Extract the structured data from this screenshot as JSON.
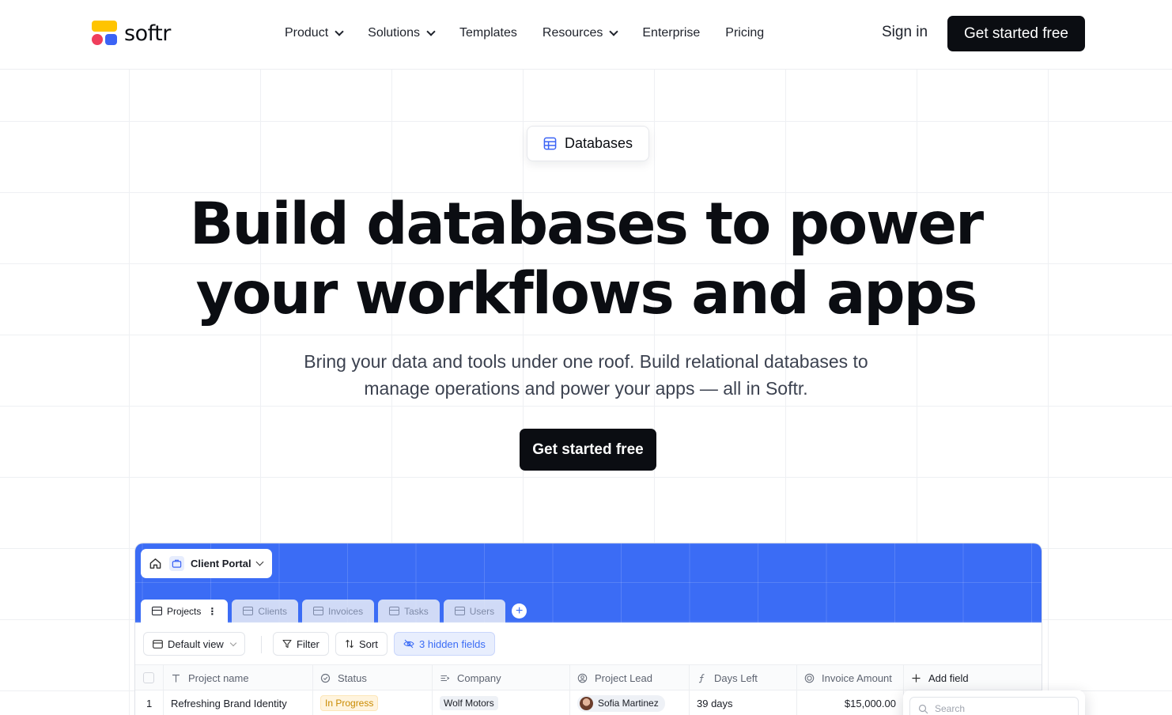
{
  "brand": {
    "name": "softr"
  },
  "nav": {
    "items": [
      {
        "label": "Product",
        "dropdown": true
      },
      {
        "label": "Solutions",
        "dropdown": true
      },
      {
        "label": "Templates",
        "dropdown": false
      },
      {
        "label": "Resources",
        "dropdown": true
      },
      {
        "label": "Enterprise",
        "dropdown": false
      },
      {
        "label": "Pricing",
        "dropdown": false
      }
    ],
    "signin_label": "Sign in",
    "cta_label": "Get started free"
  },
  "hero": {
    "badge": "Databases",
    "title_line1": "Build databases to power",
    "title_line2": "your workflows and apps",
    "subtitle_line1": "Bring your data and tools under one roof. Build relational databases to",
    "subtitle_line2": "manage operations and power your apps — all in Softr.",
    "cta_label": "Get started free"
  },
  "app": {
    "workspace": "Client Portal",
    "tabs": [
      {
        "label": "Projects",
        "active": true
      },
      {
        "label": "Clients",
        "active": false
      },
      {
        "label": "Invoices",
        "active": false
      },
      {
        "label": "Tasks",
        "active": false
      },
      {
        "label": "Users",
        "active": false
      }
    ],
    "toolbar": {
      "view_label": "Default view",
      "filter_label": "Filter",
      "sort_label": "Sort",
      "hidden_fields_label": "3 hidden fields"
    },
    "columns": [
      {
        "label": "Project name",
        "icon": "text-type-icon"
      },
      {
        "label": "Status",
        "icon": "status-circle-icon"
      },
      {
        "label": "Company",
        "icon": "link-record-icon"
      },
      {
        "label": "Project Lead",
        "icon": "user-circle-icon"
      },
      {
        "label": "Days Left",
        "icon": "formula-icon"
      },
      {
        "label": "Invoice Amount",
        "icon": "currency-icon"
      }
    ],
    "add_field_label": "Add field",
    "rows": [
      {
        "index": "1",
        "project_name": "Refreshing Brand Identity",
        "status": "In Progress",
        "company": "Wolf Motors",
        "lead": "Sofia Martinez",
        "days_left": "39 days",
        "invoice_amount": "$15,000.00"
      }
    ],
    "search_placeholder": "Search"
  },
  "colors": {
    "accent": "#3b6cf5",
    "logo_yellow": "#ffc400",
    "logo_red": "#ef3e5c",
    "logo_blue": "#3b63f5",
    "cta_bg": "#0b0d12"
  }
}
